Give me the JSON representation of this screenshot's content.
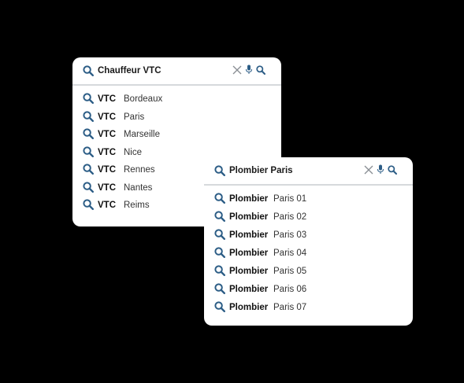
{
  "colors": {
    "accent": "#2c5d86",
    "background": "#000000",
    "panel": "#ffffff"
  },
  "icons": {
    "search": "search-icon",
    "clear": "close-icon",
    "voice": "microphone-icon"
  },
  "box1": {
    "query": "Chauffeur VTC",
    "suggestions": [
      {
        "keyword": "VTC",
        "value": "Bordeaux"
      },
      {
        "keyword": "VTC",
        "value": "Paris"
      },
      {
        "keyword": "VTC",
        "value": "Marseille"
      },
      {
        "keyword": "VTC",
        "value": "Nice"
      },
      {
        "keyword": "VTC",
        "value": "Rennes"
      },
      {
        "keyword": "VTC",
        "value": "Nantes"
      },
      {
        "keyword": "VTC",
        "value": "Reims"
      }
    ]
  },
  "box2": {
    "query": "Plombier Paris",
    "suggestions": [
      {
        "keyword": "Plombier",
        "value": "Paris 01"
      },
      {
        "keyword": "Plombier",
        "value": "Paris 02"
      },
      {
        "keyword": "Plombier",
        "value": "Paris 03"
      },
      {
        "keyword": "Plombier",
        "value": "Paris 04"
      },
      {
        "keyword": "Plombier",
        "value": "Paris 05"
      },
      {
        "keyword": "Plombier",
        "value": "Paris 06"
      },
      {
        "keyword": "Plombier",
        "value": "Paris 07"
      }
    ]
  }
}
